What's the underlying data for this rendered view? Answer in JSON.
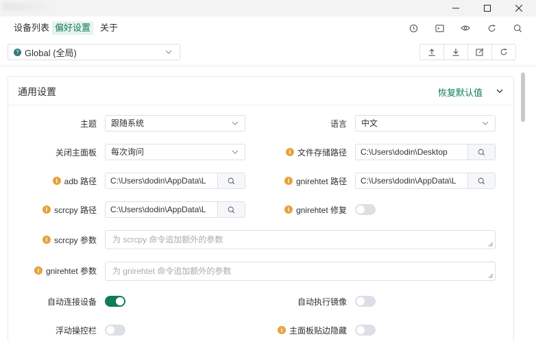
{
  "window": {
    "minimize_icon": "minimize-icon",
    "maximize_icon": "maximize-icon",
    "close_icon": "close-icon"
  },
  "nav": {
    "tabs": [
      {
        "label": "设备列表",
        "active": false
      },
      {
        "label": "偏好设置",
        "active": true
      },
      {
        "label": "关于",
        "active": false
      }
    ],
    "icons": [
      "history-icon",
      "terminal-icon",
      "eye-icon",
      "refresh-icon",
      "search-icon"
    ]
  },
  "scope": {
    "value": "Global (全局)"
  },
  "toolbar": {
    "icons": [
      "upload-icon",
      "download-icon",
      "edit-icon",
      "reset-icon"
    ]
  },
  "card": {
    "title": "通用设置",
    "restore_label": "恢复默认值"
  },
  "settings": {
    "theme": {
      "label": "主题",
      "value": "跟随系统"
    },
    "language": {
      "label": "语言",
      "value": "中文"
    },
    "close_panel": {
      "label": "关闭主面板",
      "value": "每次询问"
    },
    "file_path": {
      "label": "文件存储路径",
      "value": "C:\\Users\\dodin\\Desktop"
    },
    "adb_path": {
      "label": "adb 路径",
      "value": "C:\\Users\\dodin\\AppData\\L"
    },
    "gnirehtet_path": {
      "label": "gnirehtet 路径",
      "value": "C:\\Users\\dodin\\AppData\\L"
    },
    "scrcpy_path": {
      "label": "scrcpy 路径",
      "value": "C:\\Users\\dodin\\AppData\\L"
    },
    "gnirehtet_fix": {
      "label": "gnirehtet 修复",
      "on": false
    },
    "scrcpy_args": {
      "label": "scrcpy 参数",
      "placeholder": "为 scrcpy 命令追加额外的参数"
    },
    "gnirehtet_args": {
      "label": "gnirehtet 参数",
      "placeholder": "为 gnirehtet 命令追加额外的参数"
    },
    "auto_connect": {
      "label": "自动连接设备",
      "on": true
    },
    "auto_mirror": {
      "label": "自动执行镜像",
      "on": false
    },
    "float_bar": {
      "label": "浮动操控栏",
      "on": false
    },
    "edge_hide": {
      "label": "主面板贴边隐藏",
      "on": false
    }
  },
  "colors": {
    "accent": "#0f7a5c",
    "warning": "#e6a23c"
  }
}
